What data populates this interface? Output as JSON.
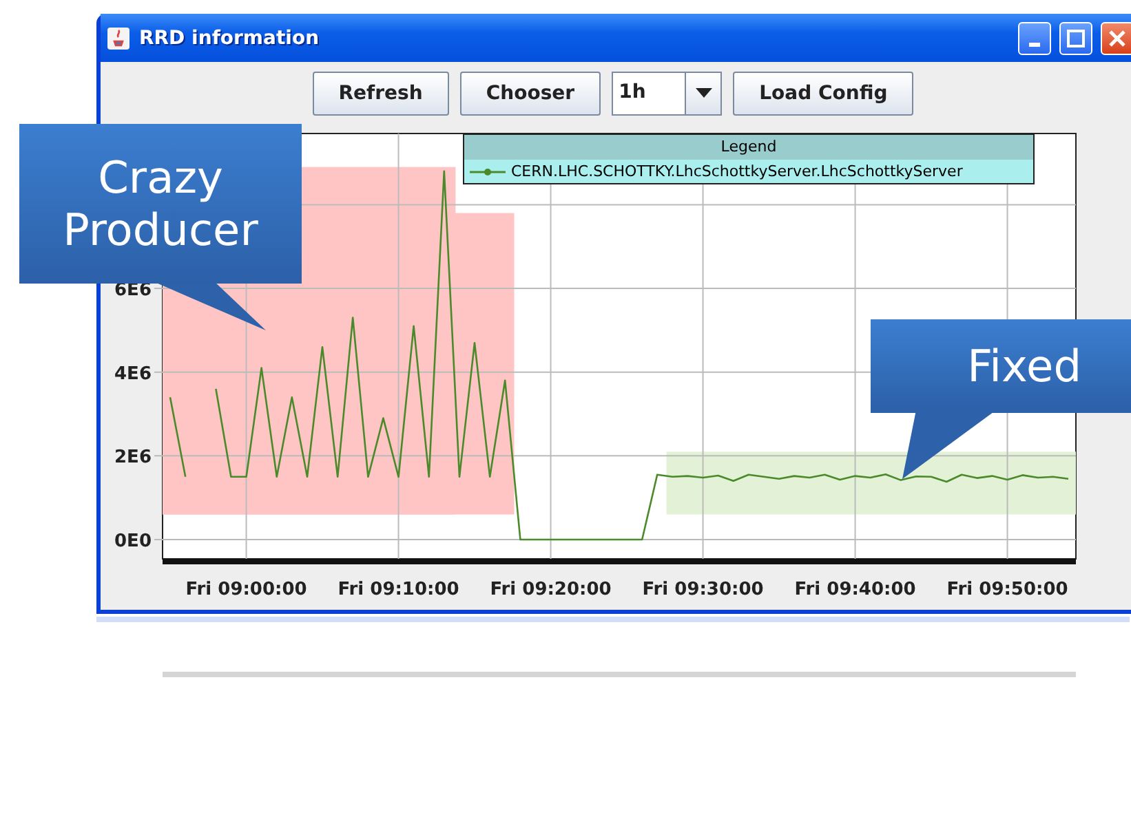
{
  "window": {
    "title": "RRD information"
  },
  "toolbar": {
    "buttons": [
      "Refresh",
      "Chooser"
    ],
    "period": {
      "value": "1h"
    },
    "load_button": "Load Config"
  },
  "legend": {
    "title": "Legend"
  },
  "chart_data": {
    "type": "line",
    "categories": [
      null,
      null,
      null,
      null,
      null,
      "Fri 09:00:00",
      null,
      null,
      null,
      null,
      null,
      null,
      null,
      null,
      null,
      "Fri 09:10:00",
      null,
      null,
      null,
      null,
      null,
      null,
      null,
      null,
      null,
      "Fri 09:20:00",
      null,
      null,
      null,
      null,
      null,
      null,
      null,
      null,
      null,
      "Fri 09:30:00",
      null,
      null,
      null,
      null,
      null,
      null,
      null,
      null,
      null,
      "Fri 09:40:00",
      null,
      null,
      null,
      null,
      null,
      null,
      null,
      null,
      null,
      "Fri 09:50:00",
      null,
      null,
      null,
      null
    ],
    "series": [
      {
        "name": "CERN.LHC.SCHOTTKY.LhcSchottkyServer.LhcSchottkyServer",
        "color": "#4a8a2a",
        "values": [
          3400000,
          1500000,
          null,
          3600000,
          1500000,
          1500000,
          4100000,
          1500000,
          3400000,
          1500000,
          4600000,
          1500000,
          5300000,
          1500000,
          2900000,
          1500000,
          5100000,
          1500000,
          8800000,
          1500000,
          4700000,
          1500000,
          3800000,
          0,
          0,
          0,
          0,
          0,
          0,
          0,
          0,
          0,
          1550000,
          1500000,
          1520000,
          1480000,
          1530000,
          1400000,
          1550000,
          1500000,
          1450000,
          1520000,
          1480000,
          1550000,
          1430000,
          1520000,
          1480000,
          1560000,
          1420000,
          1510000,
          1500000,
          1380000,
          1550000,
          1470000,
          1520000,
          1430000,
          1540000,
          1480000,
          1500000,
          1450000
        ]
      }
    ],
    "ylim": [
      -460000,
      9700000
    ],
    "yticks": [
      {
        "value": 0,
        "label": "0E0"
      },
      {
        "value": 2000000,
        "label": "2E6"
      },
      {
        "value": 4000000,
        "label": "4E6"
      },
      {
        "value": 6000000,
        "label": "6E6"
      }
    ],
    "grid": true
  },
  "highlights": [
    {
      "color": "#ffc4c4"
    },
    {
      "color": "#ffc4c4"
    },
    {
      "color": "#e3f2d6"
    }
  ],
  "callouts": [
    {
      "text": "Crazy Producer"
    },
    {
      "text": "Fixed"
    }
  ]
}
